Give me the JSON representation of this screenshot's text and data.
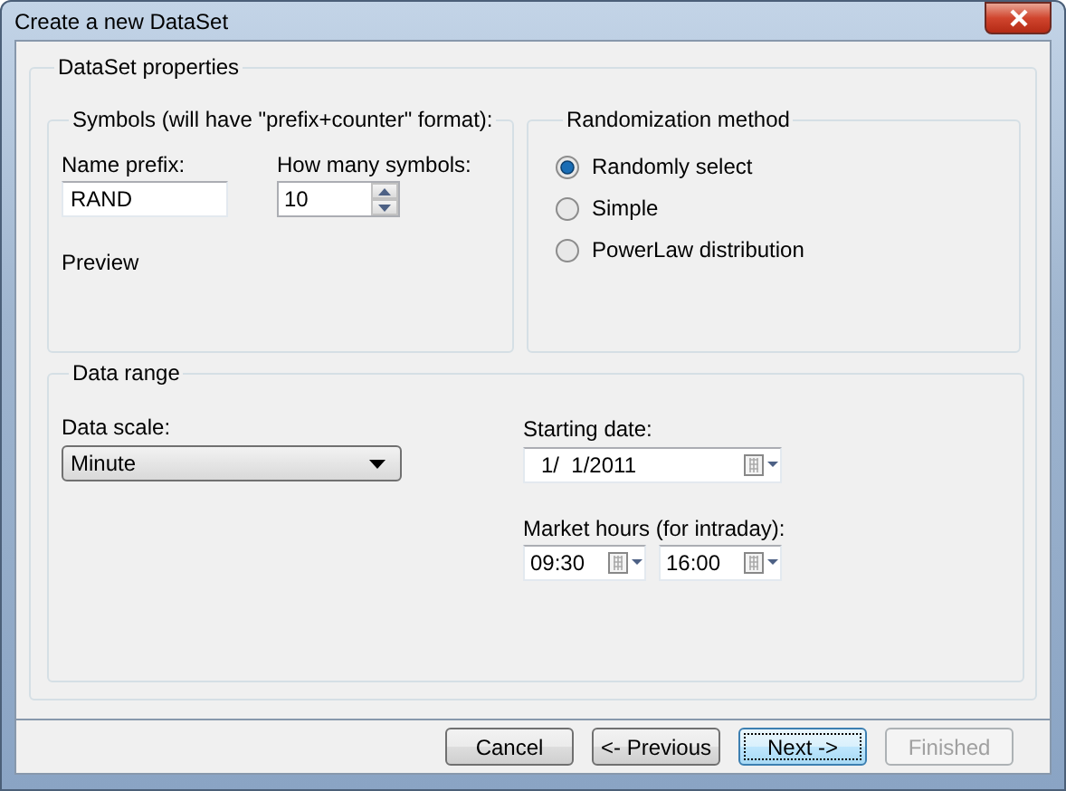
{
  "window": {
    "title": "Create a new DataSet"
  },
  "properties": {
    "title": "DataSet properties",
    "symbols": {
      "title": "Symbols (will have \"prefix+counter\" format):",
      "prefix_label": "Name prefix:",
      "prefix_value": "RAND",
      "count_label": "How many symbols:",
      "count_value": "10",
      "preview_label": "Preview"
    },
    "randomization": {
      "title": "Randomization method",
      "options": [
        {
          "label": "Randomly select",
          "selected": true
        },
        {
          "label": "Simple",
          "selected": false
        },
        {
          "label": "PowerLaw distribution",
          "selected": false
        }
      ]
    },
    "data_range": {
      "title": "Data range",
      "scale_label": "Data scale:",
      "scale_value": "Minute",
      "start_label": "Starting date:",
      "start_value": "1/  1/2011",
      "hours_label": "Market hours (for intraday):",
      "hours_from": "09:30",
      "hours_to": "16:00"
    }
  },
  "buttons": [
    {
      "label": "Cancel",
      "disabled": false,
      "focused": false
    },
    {
      "label": "<- Previous",
      "disabled": false,
      "focused": false
    },
    {
      "label": "Next ->",
      "disabled": false,
      "focused": true
    },
    {
      "label": "Finished",
      "disabled": true,
      "focused": false
    }
  ]
}
